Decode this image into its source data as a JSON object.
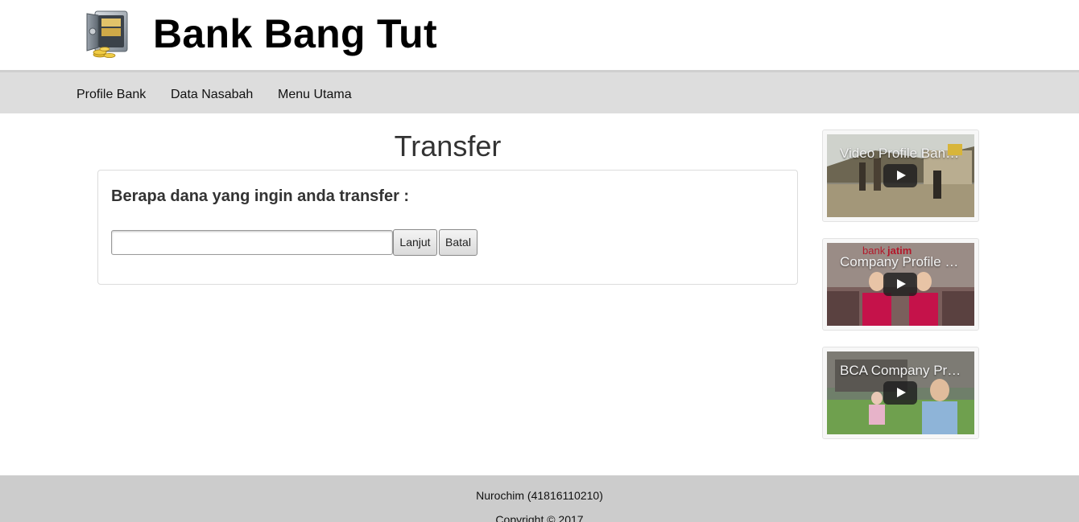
{
  "header": {
    "title": "Bank Bang Tut",
    "logo_icon": "safe-with-coins-icon"
  },
  "nav": {
    "items": [
      {
        "label": "Profile Bank"
      },
      {
        "label": "Data Nasabah"
      },
      {
        "label": "Menu Utama"
      }
    ]
  },
  "main": {
    "heading": "Transfer",
    "question": "Berapa dana yang ingin anda transfer :",
    "amount": {
      "value": "",
      "placeholder": ""
    },
    "buttons": {
      "next": "Lanjut",
      "cancel": "Batal"
    }
  },
  "videos": [
    {
      "title": "Video Profile Bank Jatim",
      "icon": "play-icon"
    },
    {
      "title": "Company Profile Bank Jatim",
      "icon": "play-icon"
    },
    {
      "title": "BCA Company Profile",
      "icon": "play-icon"
    }
  ],
  "footer": {
    "author": "Nurochim (41816110210)",
    "copyright": "Copyright © 2017"
  },
  "colors": {
    "navbar_bg": "#dddddd",
    "footer_bg": "#cccccc",
    "text": "#333333"
  }
}
